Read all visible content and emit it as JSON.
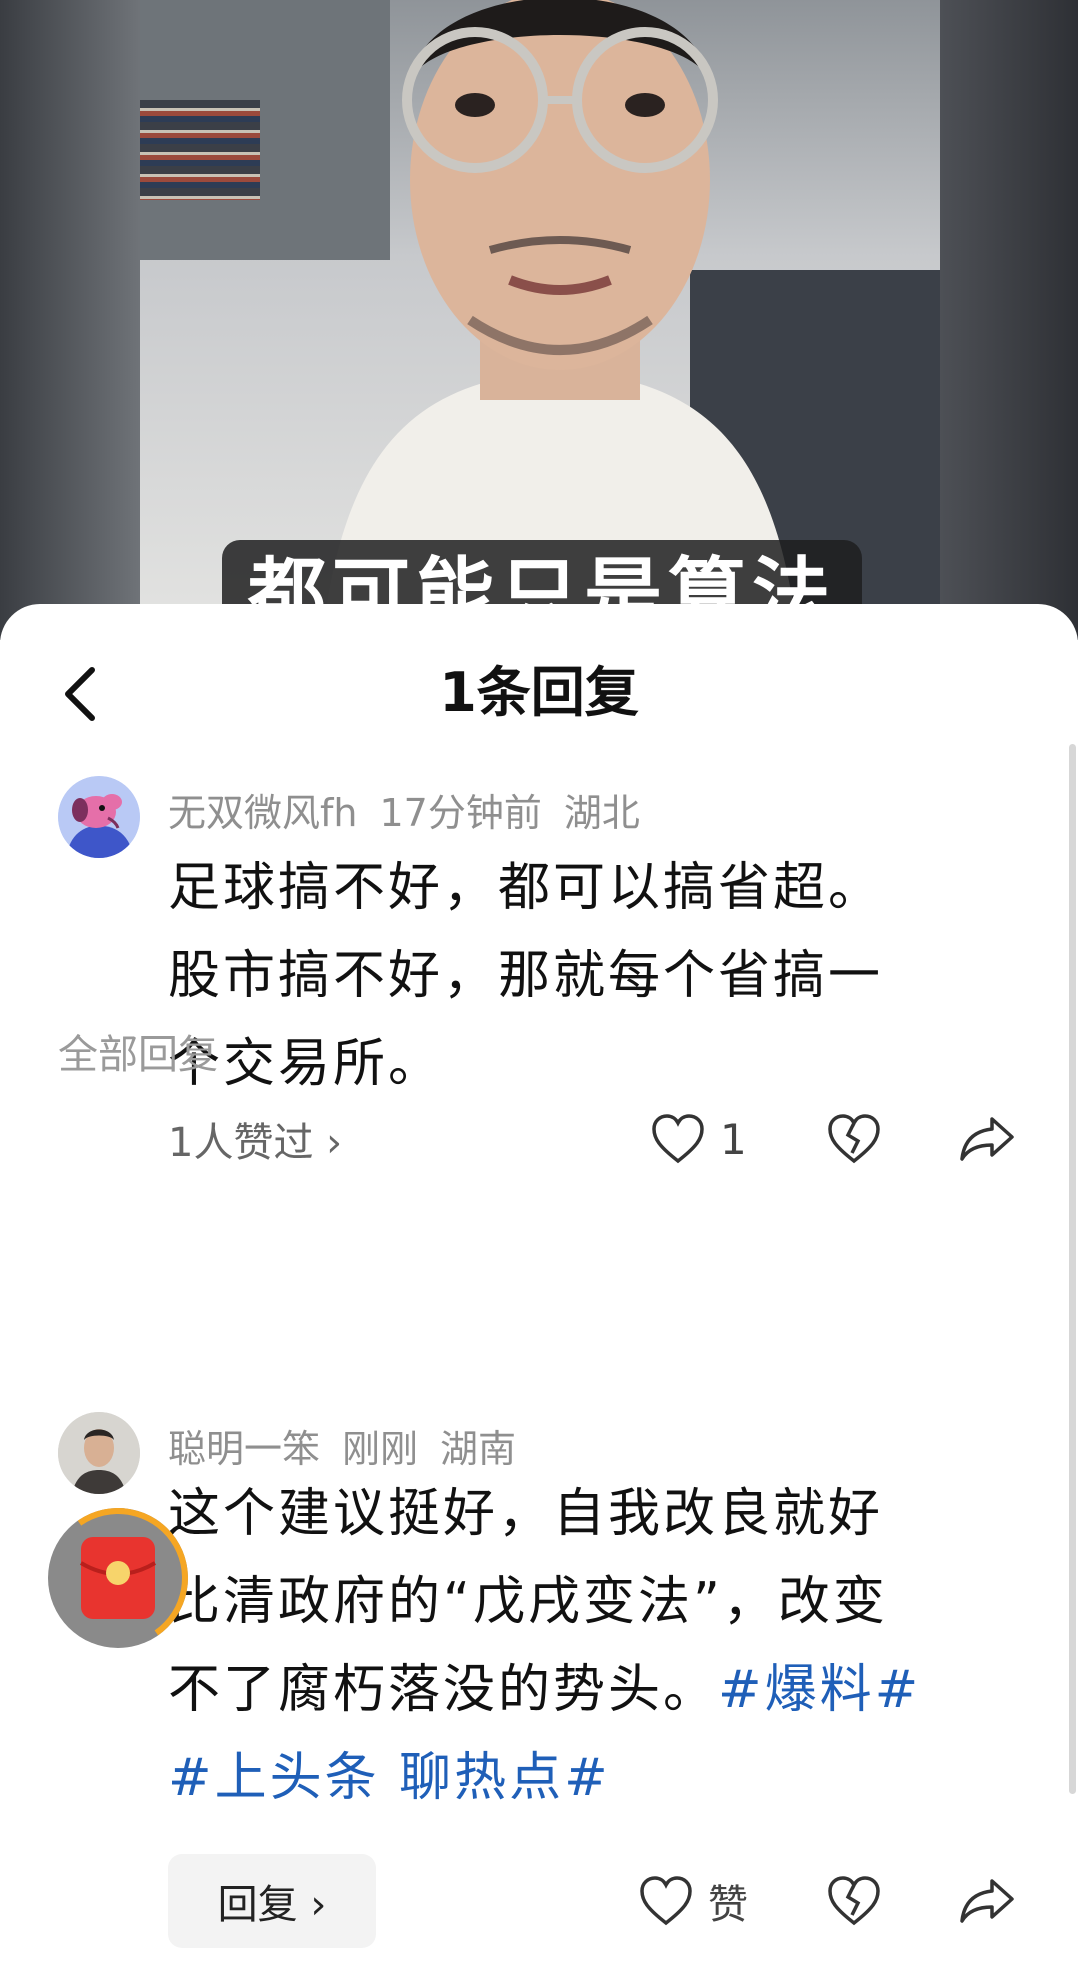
{
  "video": {
    "caption": "都可能只是算法里"
  },
  "sheet": {
    "title": "1条回复"
  },
  "comment": {
    "username": "无双微风fh",
    "time": "17分钟前",
    "location": "湖北",
    "lines": [
      "足球搞不好，都可以搞省超。",
      "股市搞不好，那就每个省搞一",
      "个交易所。"
    ],
    "likes_summary": "1人赞过 ›",
    "like_count": "1"
  },
  "section_label": "全部回复",
  "reply": {
    "username": "聪明一笨",
    "time": "刚刚",
    "location": "湖南",
    "line1": "这个建议挺好，自我改良就好",
    "line2": "比清政府的“戊戌变法”，改变",
    "line3_text": "不了腐朽落没的势头。",
    "line3_tag": "#爆料#",
    "line4_tag": "#上头条 聊热点#",
    "reply_button": "回复 ›",
    "like_label": "赞"
  },
  "icons": [
    "back-icon",
    "heart-icon",
    "broken-heart-icon",
    "share-icon",
    "red-packet-icon"
  ],
  "colors": {
    "accent_link": "#1f5fb8",
    "meta_gray": "#8f8f8f",
    "red_packet": "#e8342f"
  }
}
